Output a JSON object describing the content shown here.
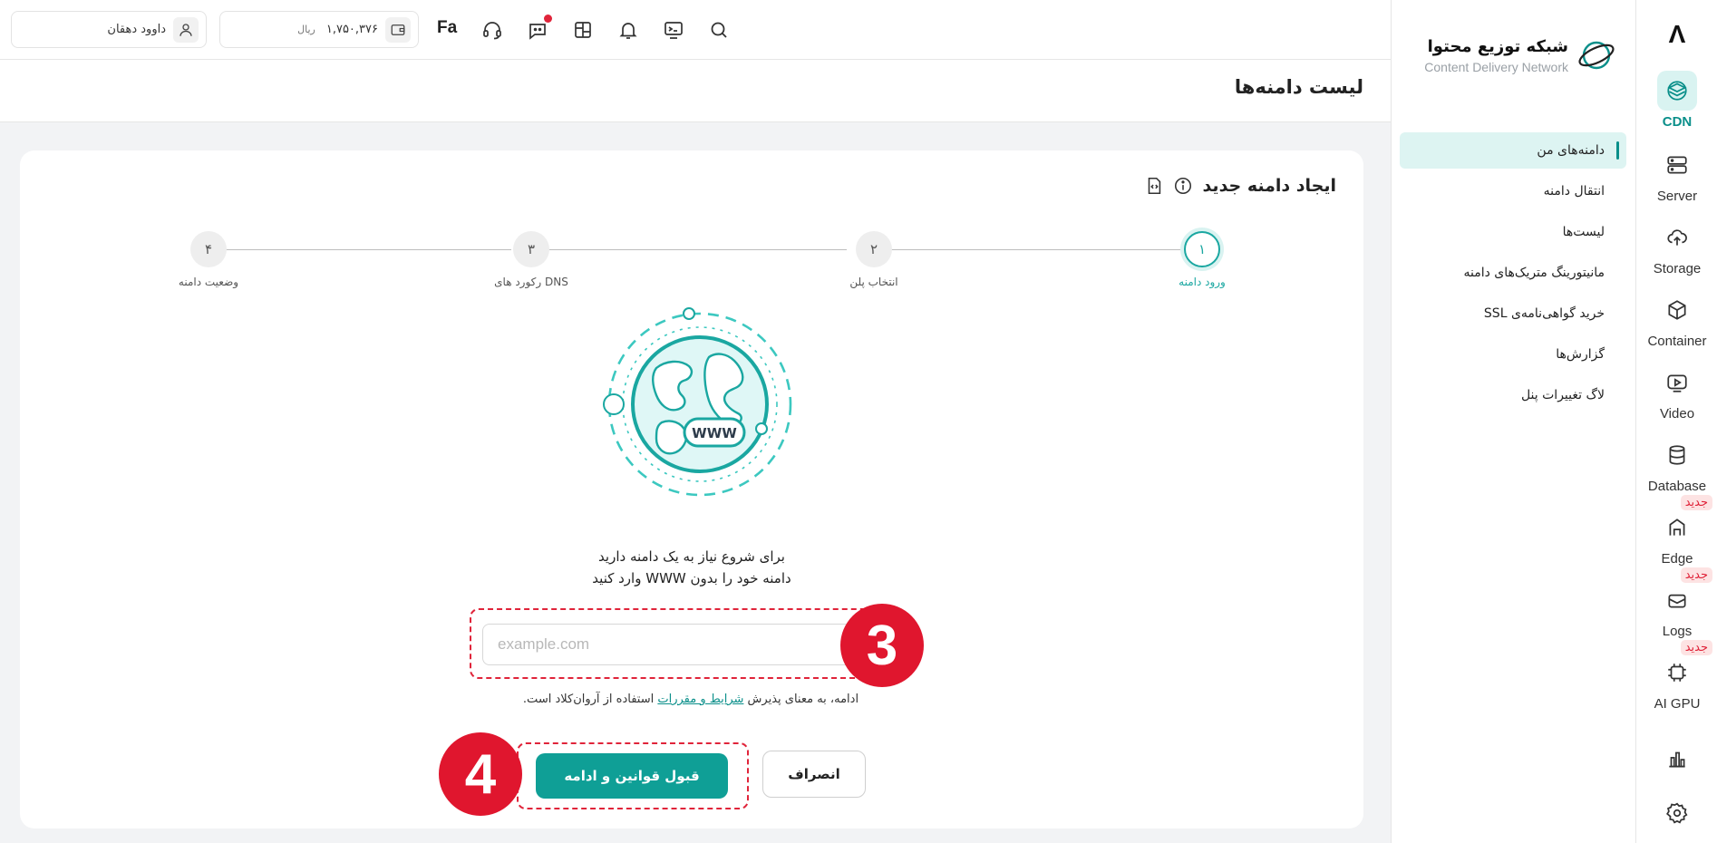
{
  "rail": {
    "logo": "Λ",
    "items": [
      {
        "label": "CDN",
        "icon": "cdn-icon",
        "active": true
      },
      {
        "label": "Server",
        "icon": "server-icon"
      },
      {
        "label": "Storage",
        "icon": "cloud-upload-icon"
      },
      {
        "label": "Container",
        "icon": "cube-icon"
      },
      {
        "label": "Video",
        "icon": "video-icon"
      },
      {
        "label": "Database",
        "icon": "database-icon"
      },
      {
        "label": "Edge",
        "icon": "edge-icon",
        "badge": "جدید"
      },
      {
        "label": "Logs",
        "icon": "logs-icon",
        "badge": "جدید"
      },
      {
        "label": "AI GPU",
        "icon": "gpu-icon",
        "badge": "جدید"
      }
    ]
  },
  "sidebar": {
    "brand_title": "شبکه توزیع محتوا",
    "brand_subtitle": "Content Delivery Network",
    "items": [
      {
        "label": "دامنه‌های من",
        "active": true
      },
      {
        "label": "انتقال دامنه"
      },
      {
        "label": "لیست‌ها"
      },
      {
        "label": "مانیتورینگ متریک‌های دامنه"
      },
      {
        "label": "خرید گواهی‌نامه‌ی SSL"
      },
      {
        "label": "گزارش‌ها"
      },
      {
        "label": "لاگ تغییرات پنل"
      }
    ]
  },
  "topbar": {
    "user_name": "داوود دهقان",
    "wallet_amount": "۱,۷۵۰,۳۷۶",
    "wallet_currency": "ریال",
    "language": "Fa"
  },
  "page": {
    "title": "لیست دامنه‌ها"
  },
  "card": {
    "title": "ایجاد دامنه جدید",
    "steps": [
      {
        "num": "۱",
        "label": "ورود دامنه",
        "active": true
      },
      {
        "num": "۲",
        "label": "انتخاب پلن"
      },
      {
        "num": "۳",
        "label": "رکورد های DNS"
      },
      {
        "num": "۴",
        "label": "وضعیت دامنه"
      }
    ],
    "globe_text": "WWW",
    "intro_line1": "برای شروع نیاز به یک دامنه دارید",
    "intro_line2": "دامنه خود را بدون WWW وارد کنید",
    "domain_placeholder": "example.com",
    "terms_before": "ادامه، به معنای پذیرش ",
    "terms_link": "شرایط و مقررات",
    "terms_after": " استفاده از آروان‌کلاد است.",
    "accept_button": "قبول قوانین و ادامه",
    "cancel_button": "انصراف",
    "annotation_domain": "3",
    "annotation_actions": "4"
  },
  "colors": {
    "accent": "#0f9f96",
    "annotation": "#e0162e"
  }
}
